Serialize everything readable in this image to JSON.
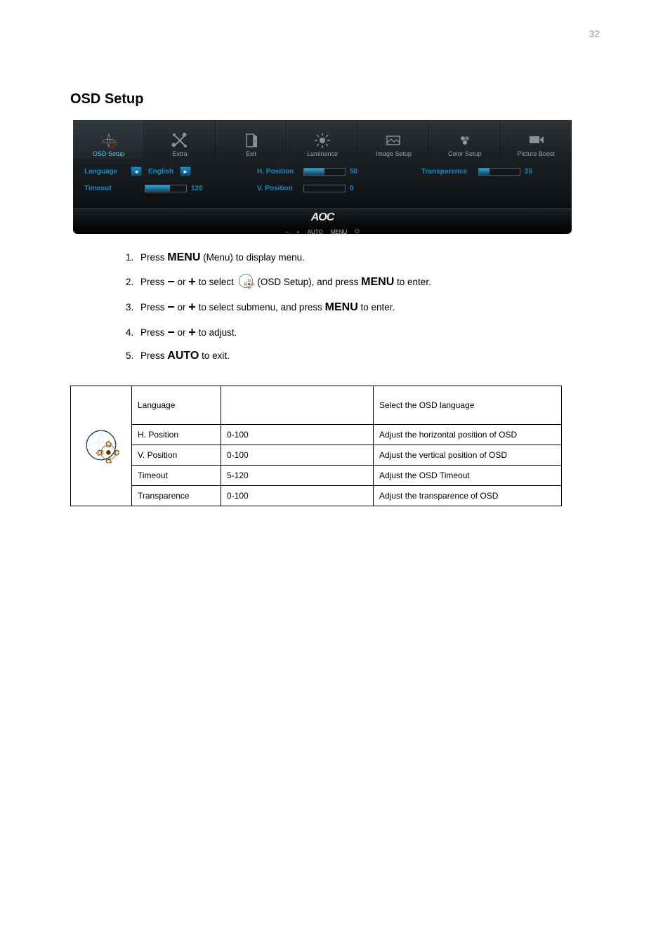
{
  "page_number_top": "32",
  "section_title": "OSD Setup",
  "osd": {
    "tabs": [
      {
        "key": "osd-setup",
        "label": "OSD Setup",
        "active": true
      },
      {
        "key": "extra",
        "label": "Extra",
        "active": false
      },
      {
        "key": "exit",
        "label": "Exit",
        "active": false
      },
      {
        "key": "luminance",
        "label": "Luminance",
        "active": false
      },
      {
        "key": "image-setup",
        "label": "Image Setup",
        "active": false
      },
      {
        "key": "color-setup",
        "label": "Color Setup",
        "active": false
      },
      {
        "key": "picture-boost",
        "label": "Picture Boost",
        "active": false
      }
    ],
    "settings": {
      "language": {
        "label": "Language",
        "value": "English"
      },
      "timeout": {
        "label": "Timeout",
        "value": "120",
        "pct": 60
      },
      "hpos": {
        "label": "H. Position",
        "value": "50",
        "pct": 50
      },
      "vpos": {
        "label": "V. Position",
        "value": "0",
        "pct": 0
      },
      "transp": {
        "label": "Transparence",
        "value": "25",
        "pct": 25
      }
    },
    "footer": {
      "logo": "AOC",
      "symbols": {
        "minus": "−",
        "plus": "+",
        "auto": "AUTO",
        "menu": "MENU",
        "power": "⏻"
      }
    }
  },
  "instructions": {
    "items": [
      {
        "pre": "Press ",
        "key": "MENU",
        "post": " (Menu) to display menu."
      },
      {
        "pre": "Press ",
        "s1": "−",
        "mid1": " or ",
        "s2": "+",
        "mid2": "  to select ",
        "icon": true,
        "mid3": "  (OSD Setup), and press ",
        "key": "MENU",
        "post": " to enter."
      },
      {
        "pre": "Press ",
        "s1": "−",
        "mid1": " or ",
        "s2": "+",
        "mid2": "  to select submenu, and press ",
        "key": "MENU",
        "post": " to enter."
      },
      {
        "pre": "Press ",
        "s1": "−",
        "mid1": " or ",
        "s2": "+",
        "post": "  to adjust."
      },
      {
        "pre": "Press ",
        "key": "AUTO",
        "post": " to exit."
      }
    ]
  },
  "settings_table": {
    "rows": [
      {
        "name": "Language",
        "values": "",
        "desc": "Select the OSD language"
      },
      {
        "name": "H. Position",
        "values": "0-100",
        "desc": "Adjust the horizontal position of OSD"
      },
      {
        "name": "V. Position",
        "values": "0-100",
        "desc": "Adjust the vertical position of OSD"
      },
      {
        "name": "Timeout",
        "values": "5-120",
        "desc": "Adjust the OSD Timeout"
      },
      {
        "name": "Transparence",
        "values": "0-100",
        "desc": "Adjust the transparence of OSD"
      }
    ]
  }
}
